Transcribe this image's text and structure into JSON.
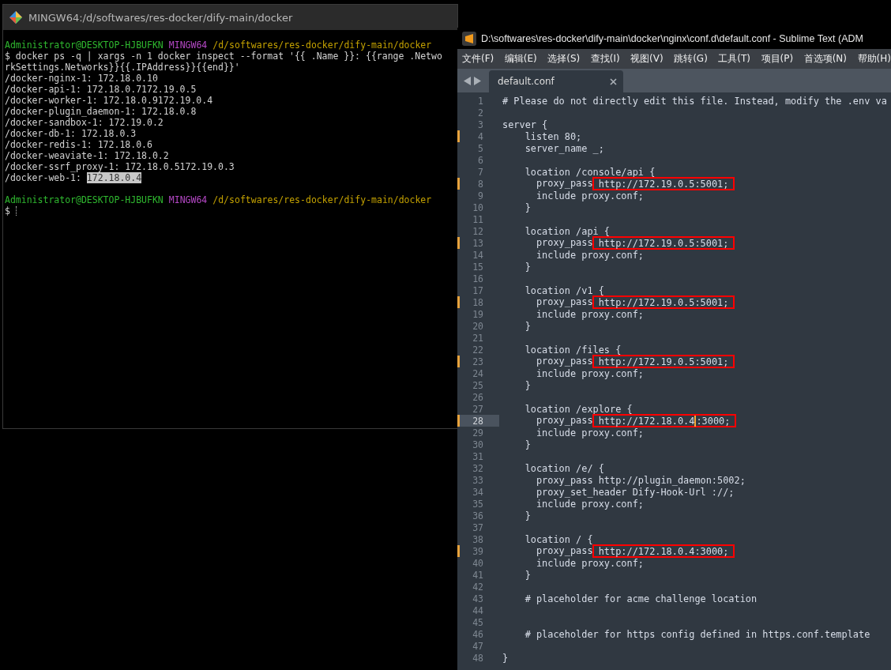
{
  "terminal": {
    "title": "MINGW64:/d/softwares/res-docker/dify-main/docker",
    "blocks": [
      {
        "lines": [
          {
            "segments": [
              {
                "kind": "user",
                "text": "Administrator@DESKTOP-HJBUFKN"
              },
              {
                "kind": "host",
                "text": "MINGW64"
              },
              {
                "kind": "path",
                "text": "/d/softwares/res-docker/dify-main/docker"
              }
            ]
          },
          {
            "segments": [
              {
                "kind": "text",
                "text": "$ docker ps -q | xargs -n 1 docker inspect --format '{{ .Name }}: {{range .Netwo"
              }
            ]
          },
          {
            "segments": [
              {
                "kind": "text",
                "text": "rkSettings.Networks}}{{.IPAddress}}{{end}}'"
              }
            ]
          },
          {
            "segments": [
              {
                "kind": "text",
                "text": "/docker-nginx-1: 172.18.0.10"
              }
            ]
          },
          {
            "segments": [
              {
                "kind": "text",
                "text": "/docker-api-1: 172.18.0.7172.19.0.5"
              }
            ]
          },
          {
            "segments": [
              {
                "kind": "text",
                "text": "/docker-worker-1: 172.18.0.9172.19.0.4"
              }
            ]
          },
          {
            "segments": [
              {
                "kind": "text",
                "text": "/docker-plugin_daemon-1: 172.18.0.8"
              }
            ]
          },
          {
            "segments": [
              {
                "kind": "text",
                "text": "/docker-sandbox-1: 172.19.0.2"
              }
            ]
          },
          {
            "segments": [
              {
                "kind": "text",
                "text": "/docker-db-1: 172.18.0.3"
              }
            ]
          },
          {
            "segments": [
              {
                "kind": "text",
                "text": "/docker-redis-1: 172.18.0.6"
              }
            ]
          },
          {
            "segments": [
              {
                "kind": "text",
                "text": "/docker-weaviate-1: 172.18.0.2"
              }
            ]
          },
          {
            "segments": [
              {
                "kind": "text",
                "text": "/docker-ssrf_proxy-1: 172.18.0.5172.19.0.3"
              }
            ]
          },
          {
            "segments": [
              {
                "kind": "text",
                "text": "/docker-web-1: "
              },
              {
                "kind": "selection",
                "text": "172.18.0.4"
              }
            ]
          }
        ]
      },
      {
        "lines": [
          {
            "segments": [
              {
                "kind": "user",
                "text": "Administrator@DESKTOP-HJBUFKN"
              },
              {
                "kind": "host",
                "text": "MINGW64"
              },
              {
                "kind": "path",
                "text": "/d/softwares/res-docker/dify-main/docker"
              }
            ]
          },
          {
            "segments": [
              {
                "kind": "text",
                "text": "$"
              },
              {
                "kind": "cursor"
              }
            ]
          }
        ]
      }
    ]
  },
  "editor": {
    "title": "D:\\softwares\\res-docker\\dify-main\\docker\\nginx\\conf.d\\default.conf - Sublime Text (ADM",
    "menu": [
      "文件(F)",
      "编辑(E)",
      "选择(S)",
      "查找(I)",
      "视图(V)",
      "跳转(G)",
      "工具(T)",
      "项目(P)",
      "首选项(N)",
      "帮助(H)"
    ],
    "tabs": [
      {
        "label": "default.conf",
        "selected": true
      }
    ],
    "lines": [
      {
        "number": "1",
        "modified": false,
        "current": false,
        "segments": [
          {
            "text": "# Please do not directly edit this file. Instead, modify the .env va"
          }
        ]
      },
      {
        "number": "2",
        "modified": false,
        "current": false
      },
      {
        "number": "3",
        "modified": false,
        "current": false,
        "segments": [
          {
            "text": "server {"
          }
        ]
      },
      {
        "number": "4",
        "modified": true,
        "current": false,
        "segments": [
          {
            "text": "    listen 80;"
          }
        ]
      },
      {
        "number": "5",
        "modified": false,
        "current": false,
        "segments": [
          {
            "text": "    server_name _;"
          }
        ]
      },
      {
        "number": "6",
        "modified": false,
        "current": false
      },
      {
        "number": "7",
        "modified": false,
        "current": false,
        "segments": [
          {
            "text": "    location /console/api {"
          }
        ]
      },
      {
        "number": "8",
        "modified": true,
        "current": false,
        "segments": [
          {
            "text": "      proxy_pass "
          },
          {
            "text": "http://172.19.0.5:5001;",
            "boxed": true
          }
        ]
      },
      {
        "number": "9",
        "modified": false,
        "current": false,
        "segments": [
          {
            "text": "      include proxy.conf;"
          }
        ]
      },
      {
        "number": "10",
        "modified": false,
        "current": false,
        "segments": [
          {
            "text": "    }"
          }
        ]
      },
      {
        "number": "11",
        "modified": false,
        "current": false
      },
      {
        "number": "12",
        "modified": false,
        "current": false,
        "segments": [
          {
            "text": "    location /api {"
          }
        ]
      },
      {
        "number": "13",
        "modified": true,
        "current": false,
        "segments": [
          {
            "text": "      proxy_pass "
          },
          {
            "text": "http://172.19.0.5:5001;",
            "boxed": true
          }
        ]
      },
      {
        "number": "14",
        "modified": false,
        "current": false,
        "segments": [
          {
            "text": "      include proxy.conf;"
          }
        ]
      },
      {
        "number": "15",
        "modified": false,
        "current": false,
        "segments": [
          {
            "text": "    }"
          }
        ]
      },
      {
        "number": "16",
        "modified": false,
        "current": false
      },
      {
        "number": "17",
        "modified": false,
        "current": false,
        "segments": [
          {
            "text": "    location /v1 {"
          }
        ]
      },
      {
        "number": "18",
        "modified": true,
        "current": false,
        "segments": [
          {
            "text": "      proxy_pass "
          },
          {
            "text": "http://172.19.0.5:5001;",
            "boxed": true
          }
        ]
      },
      {
        "number": "19",
        "modified": false,
        "current": false,
        "segments": [
          {
            "text": "      include proxy.conf;"
          }
        ]
      },
      {
        "number": "20",
        "modified": false,
        "current": false,
        "segments": [
          {
            "text": "    }"
          }
        ]
      },
      {
        "number": "21",
        "modified": false,
        "current": false
      },
      {
        "number": "22",
        "modified": false,
        "current": false,
        "segments": [
          {
            "text": "    location /files {"
          }
        ]
      },
      {
        "number": "23",
        "modified": true,
        "current": false,
        "segments": [
          {
            "text": "      proxy_pass "
          },
          {
            "text": "http://172.19.0.5:5001;",
            "boxed": true
          }
        ]
      },
      {
        "number": "24",
        "modified": false,
        "current": false,
        "segments": [
          {
            "text": "      include proxy.conf;"
          }
        ]
      },
      {
        "number": "25",
        "modified": false,
        "current": false,
        "segments": [
          {
            "text": "    }"
          }
        ]
      },
      {
        "number": "26",
        "modified": false,
        "current": false
      },
      {
        "number": "27",
        "modified": false,
        "current": false,
        "segments": [
          {
            "text": "    location /explore {"
          }
        ]
      },
      {
        "number": "28",
        "modified": true,
        "current": true,
        "segments": [
          {
            "text": "      proxy_pass "
          },
          {
            "text": "http://172.18.0.4",
            "text_after_cursor": ":3000;",
            "boxed": true
          }
        ]
      },
      {
        "number": "29",
        "modified": false,
        "current": false,
        "segments": [
          {
            "text": "      include proxy.conf;"
          }
        ]
      },
      {
        "number": "30",
        "modified": false,
        "current": false,
        "segments": [
          {
            "text": "    }"
          }
        ]
      },
      {
        "number": "31",
        "modified": false,
        "current": false
      },
      {
        "number": "32",
        "modified": false,
        "current": false,
        "segments": [
          {
            "text": "    location /e/ {"
          }
        ]
      },
      {
        "number": "33",
        "modified": false,
        "current": false,
        "segments": [
          {
            "text": "      proxy_pass http://plugin_daemon:5002;"
          }
        ]
      },
      {
        "number": "34",
        "modified": false,
        "current": false,
        "segments": [
          {
            "text": "      proxy_set_header Dify-Hook-Url ://;"
          }
        ]
      },
      {
        "number": "35",
        "modified": false,
        "current": false,
        "segments": [
          {
            "text": "      include proxy.conf;"
          }
        ]
      },
      {
        "number": "36",
        "modified": false,
        "current": false,
        "segments": [
          {
            "text": "    }"
          }
        ]
      },
      {
        "number": "37",
        "modified": false,
        "current": false
      },
      {
        "number": "38",
        "modified": false,
        "current": false,
        "segments": [
          {
            "text": "    location / {"
          }
        ]
      },
      {
        "number": "39",
        "modified": true,
        "current": false,
        "segments": [
          {
            "text": "      proxy_pass "
          },
          {
            "text": "http://172.18.0.4:3000;",
            "boxed": true
          }
        ]
      },
      {
        "number": "40",
        "modified": false,
        "current": false,
        "segments": [
          {
            "text": "      include proxy.conf;"
          }
        ]
      },
      {
        "number": "41",
        "modified": false,
        "current": false,
        "segments": [
          {
            "text": "    }"
          }
        ]
      },
      {
        "number": "42",
        "modified": false,
        "current": false
      },
      {
        "number": "43",
        "modified": false,
        "current": false,
        "segments": [
          {
            "text": "    # placeholder for acme challenge location"
          }
        ]
      },
      {
        "number": "44",
        "modified": false,
        "current": false
      },
      {
        "number": "45",
        "modified": false,
        "current": false
      },
      {
        "number": "46",
        "modified": false,
        "current": false,
        "segments": [
          {
            "text": "    # placeholder for https config defined in https.conf.template"
          }
        ]
      },
      {
        "number": "47",
        "modified": false,
        "current": false
      },
      {
        "number": "48",
        "modified": false,
        "current": false,
        "segments": [
          {
            "text": "}"
          }
        ]
      }
    ]
  }
}
